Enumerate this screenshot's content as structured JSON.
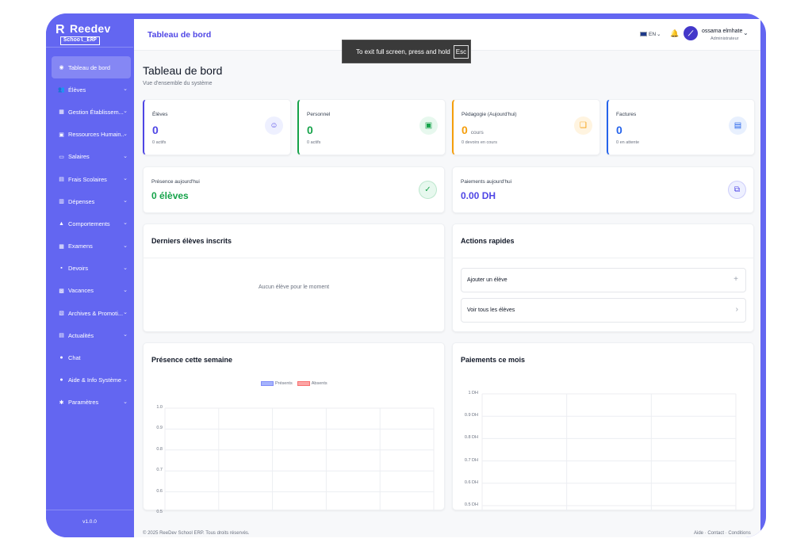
{
  "brand": {
    "name": "Reedev",
    "product": "School_ERP"
  },
  "sidebar": {
    "items": [
      {
        "label": "Tableau de bord",
        "icon": "dashboard-icon",
        "active": true,
        "chevron": false
      },
      {
        "label": "Élèves",
        "icon": "students-icon",
        "chevron": true
      },
      {
        "label": "Gestion Établissem...",
        "icon": "building-icon",
        "chevron": true
      },
      {
        "label": "Ressources Humain...",
        "icon": "hr-icon",
        "chevron": true
      },
      {
        "label": "Salaires",
        "icon": "money-icon",
        "chevron": true
      },
      {
        "label": "Frais Scolaires",
        "icon": "fees-icon",
        "chevron": true
      },
      {
        "label": "Dépenses",
        "icon": "expenses-icon",
        "chevron": true
      },
      {
        "label": "Comportements",
        "icon": "warning-icon",
        "chevron": true
      },
      {
        "label": "Examens",
        "icon": "exam-icon",
        "chevron": true
      },
      {
        "label": "Devoirs",
        "icon": "homework-icon",
        "chevron": true
      },
      {
        "label": "Vacances",
        "icon": "vacation-icon",
        "chevron": true
      },
      {
        "label": "Archives & Promoti...",
        "icon": "archive-icon",
        "chevron": true
      },
      {
        "label": "Actualités",
        "icon": "news-icon",
        "chevron": true
      },
      {
        "label": "Chat",
        "icon": "chat-icon",
        "chevron": false
      },
      {
        "label": "Aide & Info Système",
        "icon": "help-icon",
        "chevron": true
      },
      {
        "label": "Paramètres",
        "icon": "settings-icon",
        "chevron": true
      }
    ],
    "version": "v1.0.0"
  },
  "topbar": {
    "title": "Tableau de bord",
    "language": "EN",
    "user_name": "ossama elmhate",
    "user_role": "Administrateur",
    "fullscreen_msg": "To exit full screen, press and hold",
    "fullscreen_key": "Esc"
  },
  "page": {
    "title": "Tableau de bord",
    "subtitle": "Vue d'ensemble du système"
  },
  "stats": [
    {
      "label": "Élèves",
      "value": "0",
      "unit": "",
      "sub": "0 actifs",
      "color": "#4f46e5",
      "icon": "student-icon",
      "bg": "#eef0ff"
    },
    {
      "label": "Personnel",
      "value": "0",
      "unit": "",
      "sub": "0 actifs",
      "color": "#16a34a",
      "icon": "briefcase-icon",
      "bg": "#e7f8ee"
    },
    {
      "label": "Pédagogie (Aujourd'hui)",
      "value": "0",
      "unit": "cours",
      "sub": "0 devoirs en cours",
      "color": "#f59e0b",
      "icon": "book-icon",
      "bg": "#fff4e0"
    },
    {
      "label": "Factures",
      "value": "0",
      "unit": "",
      "sub": "0 en attente",
      "color": "#2563eb",
      "icon": "document-icon",
      "bg": "#e8f0fe"
    }
  ],
  "wide_stats": [
    {
      "label": "Présence aujourd'hui",
      "value": "0 élèves",
      "color": "#16a34a",
      "icon": "check-circle-icon",
      "bg": "#e7f8ee"
    },
    {
      "label": "Paiements aujourd'hui",
      "value": "0.00 DH",
      "color": "#4f46e5",
      "icon": "payment-icon",
      "bg": "#eef0ff"
    }
  ],
  "recent_students": {
    "title": "Derniers élèves inscrits",
    "empty": "Aucun élève pour le moment"
  },
  "quick_actions": {
    "title": "Actions rapides",
    "items": [
      {
        "label": "Ajouter un élève",
        "icon": "plus-icon"
      },
      {
        "label": "Voir tous les élèves",
        "icon": "chevron-right-icon"
      }
    ]
  },
  "attendance_chart": {
    "title": "Présence cette semaine",
    "legend": [
      "Présents",
      "Absents"
    ],
    "y_ticks": [
      "1.0",
      "0.9",
      "0.8",
      "0.7",
      "0.6",
      "0.5"
    ],
    "colors": {
      "present": "#a5b4fc",
      "absent": "#fca5a5"
    }
  },
  "payments_chart": {
    "title": "Paiements ce mois",
    "y_ticks": [
      "1 DH",
      "0.9 DH",
      "0.8 DH",
      "0.7 DH",
      "0.6 DH",
      "0.5 DH"
    ]
  },
  "chart_data": [
    {
      "type": "bar",
      "title": "Présence cette semaine",
      "series": [
        {
          "name": "Présents",
          "values": []
        },
        {
          "name": "Absents",
          "values": []
        }
      ],
      "ylim": [
        0.5,
        1.0
      ],
      "grid": true,
      "legend": "top-center"
    },
    {
      "type": "line",
      "title": "Paiements ce mois",
      "series": [],
      "ylim": [
        0.5,
        1.0
      ],
      "grid": true
    }
  ],
  "footer": {
    "copyright": "© 2025 ReeDev School ERP. Tous droits réservés.",
    "links": "Aide · Contact · Conditions"
  }
}
